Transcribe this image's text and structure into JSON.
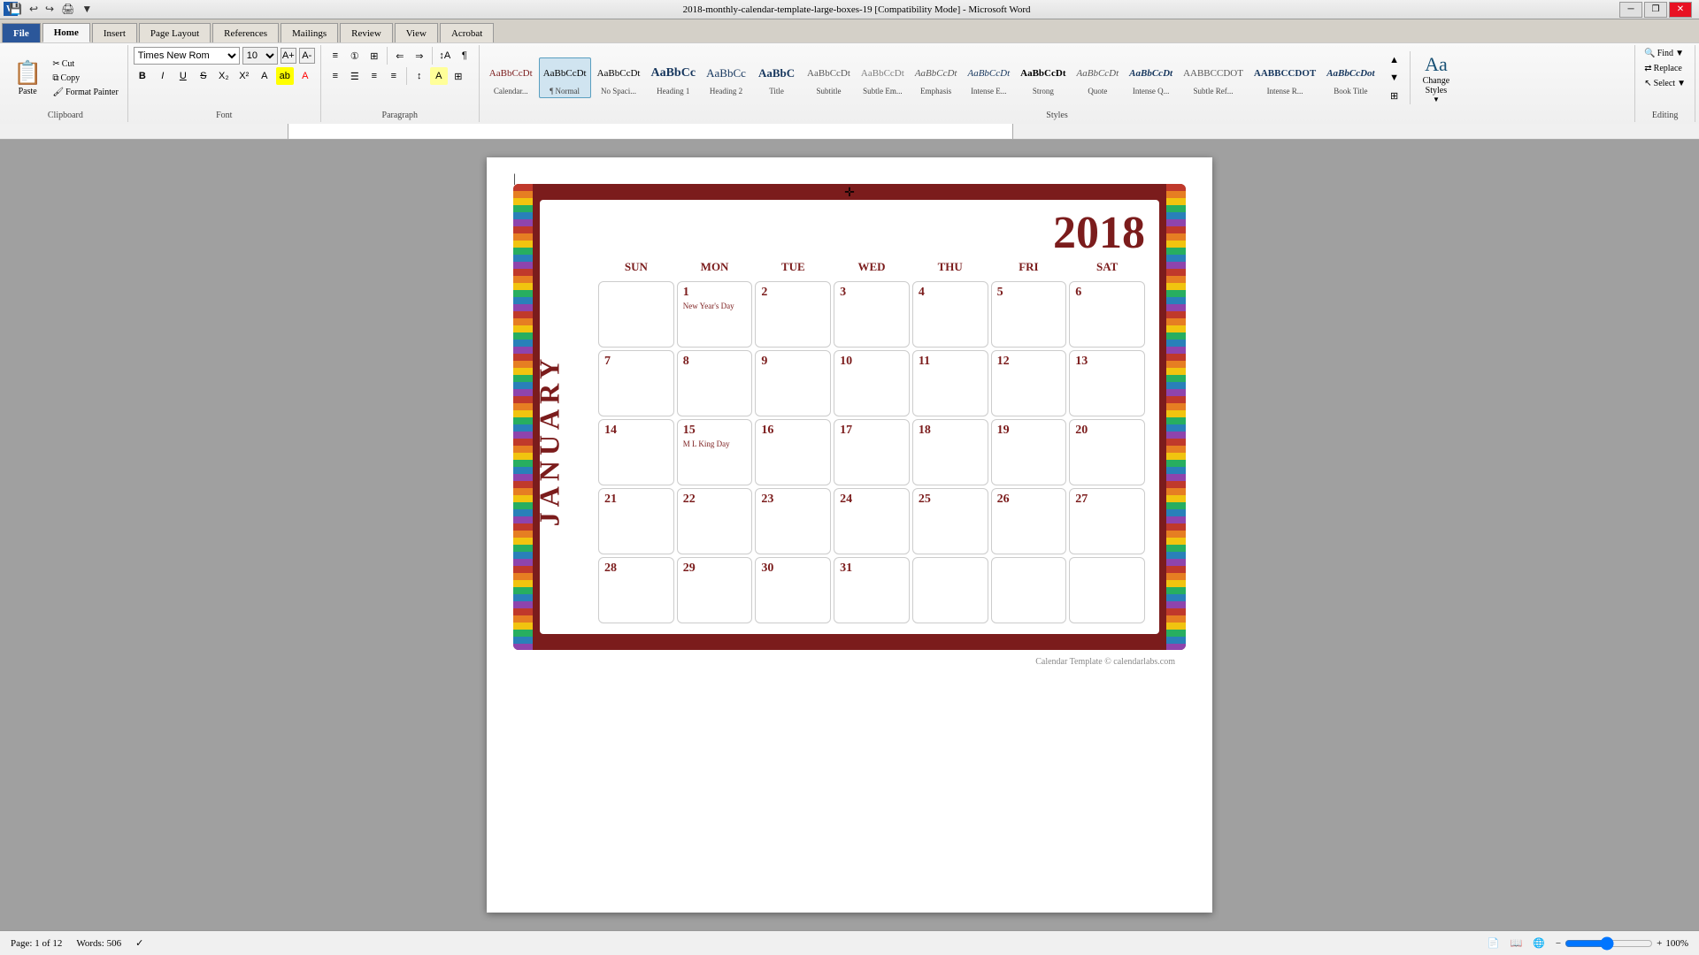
{
  "app": {
    "title": "2018-monthly-calendar-template-large-boxes-19 [Compatibility Mode] - Microsoft Word"
  },
  "window_controls": {
    "minimize": "─",
    "restore": "❐",
    "close": "✕"
  },
  "tabs": [
    {
      "id": "file",
      "label": "File"
    },
    {
      "id": "home",
      "label": "Home",
      "active": true
    },
    {
      "id": "insert",
      "label": "Insert"
    },
    {
      "id": "page_layout",
      "label": "Page Layout"
    },
    {
      "id": "references",
      "label": "References"
    },
    {
      "id": "mailings",
      "label": "Mailings"
    },
    {
      "id": "review",
      "label": "Review"
    },
    {
      "id": "view",
      "label": "View"
    },
    {
      "id": "acrobat",
      "label": "Acrobat"
    }
  ],
  "ribbon": {
    "clipboard": {
      "label": "Clipboard",
      "paste_label": "Paste",
      "cut_label": "Cut",
      "copy_label": "Copy",
      "format_painter_label": "Format Painter"
    },
    "font": {
      "label": "Font",
      "font_name": "Times New Rom",
      "font_size": "10",
      "bold": "B",
      "italic": "I",
      "underline": "U"
    },
    "paragraph": {
      "label": "Paragraph"
    },
    "styles": {
      "label": "Styles",
      "items": [
        {
          "id": "aaabbcct",
          "label": "Calendar..."
        },
        {
          "id": "normal",
          "label": "¶ Normal",
          "active": true
        },
        {
          "id": "no_spacing",
          "label": "No Spaci..."
        },
        {
          "id": "heading1",
          "label": "Heading 1"
        },
        {
          "id": "heading2",
          "label": "Heading 2"
        },
        {
          "id": "title",
          "label": "Title"
        },
        {
          "id": "subtitle",
          "label": "Subtitle"
        },
        {
          "id": "subtle_em",
          "label": "Subtle Em..."
        },
        {
          "id": "emphasis",
          "label": "Emphasis"
        },
        {
          "id": "intense_e",
          "label": "Intense E..."
        },
        {
          "id": "strong",
          "label": "Strong"
        },
        {
          "id": "quote",
          "label": "Quote"
        },
        {
          "id": "intense_q",
          "label": "Intense Q..."
        },
        {
          "id": "subtle_ref",
          "label": "Subtle Ref..."
        },
        {
          "id": "intense_r",
          "label": "Intense R..."
        },
        {
          "id": "book_title",
          "label": "Book Title"
        }
      ],
      "change_styles_label": "Change\nStyles"
    },
    "editing": {
      "label": "Editing",
      "find_label": "Find",
      "replace_label": "Replace",
      "select_label": "Select"
    }
  },
  "calendar": {
    "year": "2018",
    "month": "JANUARY",
    "days_header": [
      "SUN",
      "MON",
      "TUE",
      "WED",
      "THU",
      "FRI",
      "SAT"
    ],
    "weeks": [
      [
        {
          "date": "",
          "event": ""
        },
        {
          "date": "1",
          "event": "New Year's Day"
        },
        {
          "date": "2",
          "event": ""
        },
        {
          "date": "3",
          "event": ""
        },
        {
          "date": "4",
          "event": ""
        },
        {
          "date": "5",
          "event": ""
        },
        {
          "date": "6",
          "event": ""
        }
      ],
      [
        {
          "date": "7",
          "event": ""
        },
        {
          "date": "8",
          "event": ""
        },
        {
          "date": "9",
          "event": ""
        },
        {
          "date": "10",
          "event": ""
        },
        {
          "date": "11",
          "event": ""
        },
        {
          "date": "12",
          "event": ""
        },
        {
          "date": "13",
          "event": ""
        }
      ],
      [
        {
          "date": "14",
          "event": ""
        },
        {
          "date": "15",
          "event": "M L King Day"
        },
        {
          "date": "16",
          "event": ""
        },
        {
          "date": "17",
          "event": ""
        },
        {
          "date": "18",
          "event": ""
        },
        {
          "date": "19",
          "event": ""
        },
        {
          "date": "20",
          "event": ""
        }
      ],
      [
        {
          "date": "21",
          "event": ""
        },
        {
          "date": "22",
          "event": ""
        },
        {
          "date": "23",
          "event": ""
        },
        {
          "date": "24",
          "event": ""
        },
        {
          "date": "25",
          "event": ""
        },
        {
          "date": "26",
          "event": ""
        },
        {
          "date": "27",
          "event": ""
        }
      ],
      [
        {
          "date": "28",
          "event": ""
        },
        {
          "date": "29",
          "event": ""
        },
        {
          "date": "30",
          "event": ""
        },
        {
          "date": "31",
          "event": ""
        },
        {
          "date": "",
          "event": ""
        },
        {
          "date": "",
          "event": ""
        },
        {
          "date": "",
          "event": ""
        }
      ]
    ],
    "copyright": "Calendar Template © calendarlabs.com"
  },
  "statusbar": {
    "page_info": "Page: 1 of 12",
    "words": "Words: 506",
    "zoom_label": "100%"
  }
}
